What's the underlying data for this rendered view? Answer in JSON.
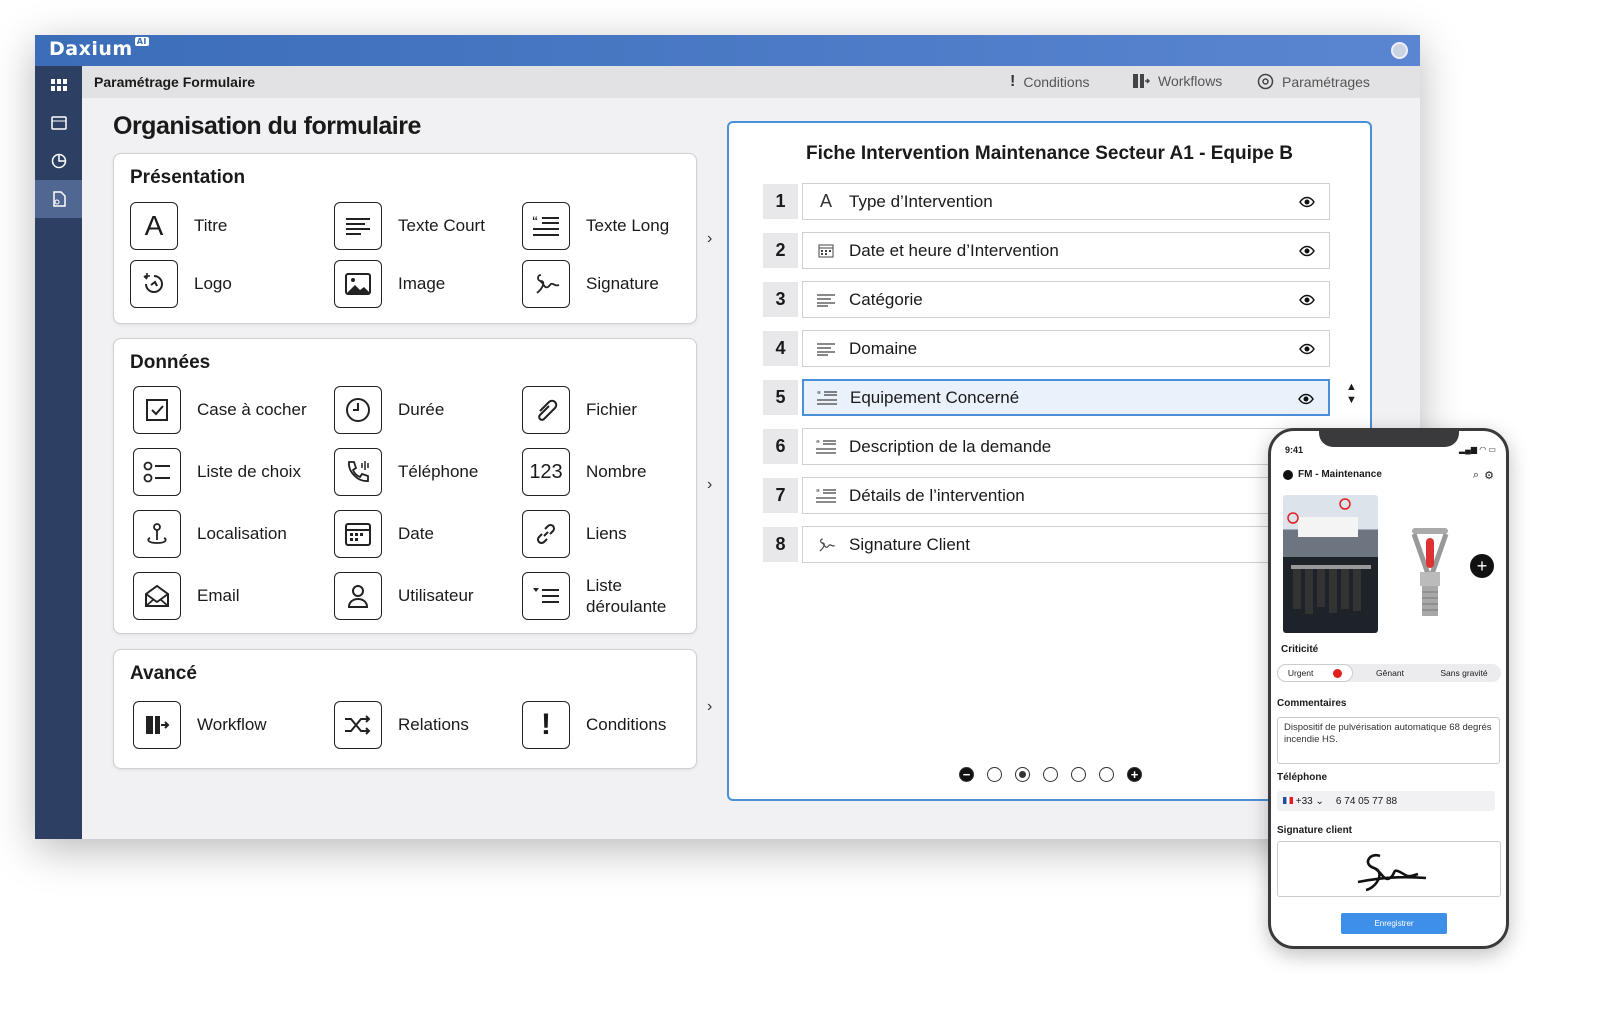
{
  "app": {
    "name": "Daxium",
    "badge": "AI"
  },
  "subbar": {
    "title": "Paramétrage Formulaire",
    "tabs": [
      {
        "label": "Conditions"
      },
      {
        "label": "Workflows"
      },
      {
        "label": "Paramétrages"
      }
    ]
  },
  "page": {
    "title": "Organisation du formulaire"
  },
  "sections": [
    {
      "title": "Présentation",
      "items": [
        {
          "label": "Titre",
          "icon": "letter-a-icon"
        },
        {
          "label": "Texte Court",
          "icon": "short-text-icon"
        },
        {
          "label": "Texte Long",
          "icon": "long-text-icon"
        },
        {
          "label": "Logo",
          "icon": "logo-icon"
        },
        {
          "label": "Image",
          "icon": "image-icon"
        },
        {
          "label": "Signature",
          "icon": "signature-icon"
        }
      ]
    },
    {
      "title": "Données",
      "items": [
        {
          "label": "Case à cocher",
          "icon": "checkbox-icon"
        },
        {
          "label": "Durée",
          "icon": "clock-icon"
        },
        {
          "label": "Fichier",
          "icon": "paperclip-icon"
        },
        {
          "label": "Liste de choix",
          "icon": "choice-list-icon"
        },
        {
          "label": "Téléphone",
          "icon": "phone-icon"
        },
        {
          "label": "Nombre",
          "icon": "number-icon"
        },
        {
          "label": "Localisation",
          "icon": "location-icon"
        },
        {
          "label": "Date",
          "icon": "calendar-icon"
        },
        {
          "label": "Liens",
          "icon": "link-icon"
        },
        {
          "label": "Email",
          "icon": "email-icon"
        },
        {
          "label": "Utilisateur",
          "icon": "user-icon"
        },
        {
          "label": "Liste déroulante",
          "icon": "dropdown-list-icon"
        }
      ]
    },
    {
      "title": "Avancé",
      "items": [
        {
          "label": "Workflow",
          "icon": "workflow-icon"
        },
        {
          "label": "Relations",
          "icon": "shuffle-icon"
        },
        {
          "label": "Conditions",
          "icon": "exclamation-icon"
        }
      ]
    }
  ],
  "form": {
    "title": "Fiche Intervention Maintenance Secteur A1 - Equipe B",
    "fields": [
      {
        "num": "1",
        "label": "Type d’Intervention"
      },
      {
        "num": "2",
        "label": "Date et heure d’Intervention"
      },
      {
        "num": "3",
        "label": "Catégorie"
      },
      {
        "num": "4",
        "label": "Domaine"
      },
      {
        "num": "5",
        "label": "Equipement Concerné"
      },
      {
        "num": "6",
        "label": "Description de la demande"
      },
      {
        "num": "7",
        "label": "Détails de l’intervention"
      },
      {
        "num": "8",
        "label": "Signature Client"
      }
    ],
    "selected_field": 5,
    "page_selected": 2
  },
  "phone": {
    "time": "9:41",
    "header": "FM - Maintenance",
    "criticite_label": "Criticité",
    "criticite_options": [
      "Urgent",
      "Gênant",
      "Sans gravité"
    ],
    "comments_label": "Commentaires",
    "comments_value": "Dispositif de pulvérisation automatique 68 degrés incendie HS.",
    "phone_label": "Téléphone",
    "phone_prefix": "+33",
    "phone_value": "6 74 05 77 88",
    "signature_label": "Signature client",
    "save_label": "Enregistrer"
  },
  "colors": {
    "topbar": "#4a7ac6",
    "sidebar": "#2d3f63",
    "accent": "#4a90d9",
    "urgent": "#e02020"
  }
}
